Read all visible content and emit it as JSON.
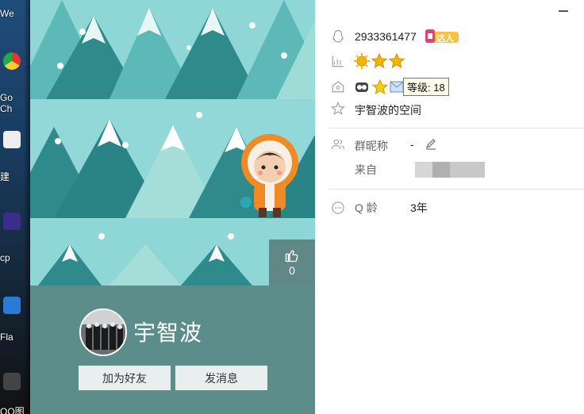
{
  "desktop": {
    "labels": [
      "We",
      "Go",
      "Ch",
      "建",
      "cp",
      "Fla",
      "QQ图"
    ]
  },
  "card": {
    "nickname": "宇智波",
    "like_count": "0",
    "buttons": {
      "add_friend": "加为好友",
      "send_message": "发消息"
    }
  },
  "info": {
    "qq_number": "2933361477",
    "talent_badge": "达人",
    "level_tooltip": "等级: 18",
    "space_link": "宇智波的空间",
    "group_nick_label": "群昵称",
    "group_nick_value": "-",
    "from_label": "来自",
    "q_age_label": "Q 龄",
    "q_age_value": "3年"
  },
  "colors": {
    "sky": "#8fd6d6",
    "tree_dark": "#2f8a8c",
    "tree_light": "#9fdcd8",
    "profile_bg": "#5d8d8a",
    "accent_orange": "#f08a24",
    "star_gold": "#f5b400"
  }
}
